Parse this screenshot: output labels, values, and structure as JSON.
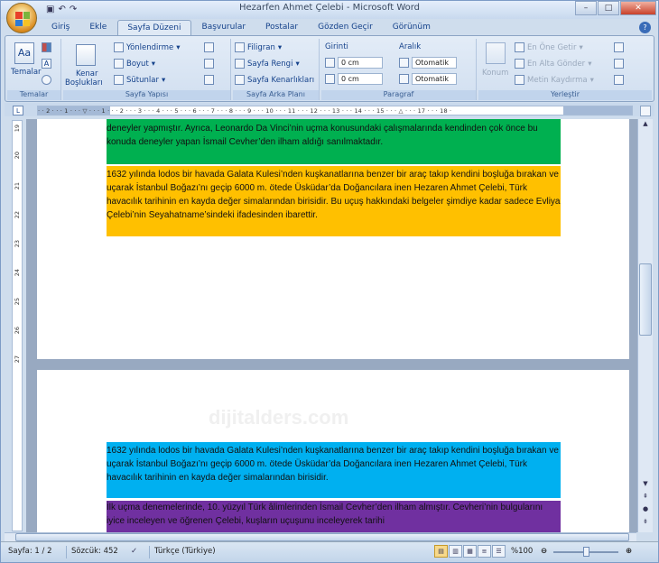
{
  "window": {
    "title": "Hezarfen Ahmet Çelebi - Microsoft Word",
    "controls": [
      "–",
      "□",
      "✕"
    ]
  },
  "quick_access": {
    "save_icon": "save-icon",
    "undo_icon": "undo-icon",
    "redo_icon": "redo-icon"
  },
  "tabs": [
    "Giriş",
    "Ekle",
    "Sayfa Düzeni",
    "Başvurular",
    "Postalar",
    "Gözden Geçir",
    "Görünüm"
  ],
  "active_tab": "Sayfa Düzeni",
  "ribbon": {
    "temalar": {
      "label": "Temalar",
      "button": "Temalar"
    },
    "sayfa_yapisi": {
      "label": "Sayfa Yapısı",
      "kenar": "Kenar",
      "bosluklari": "Boşlukları",
      "yonlendirme": "Yönlendirme",
      "boyut": "Boyut",
      "sutunlar": "Sütunlar"
    },
    "sayfa_arka_plani": {
      "label": "Sayfa Arka Planı",
      "filigran": "Filigran",
      "sayfa_rengi": "Sayfa Rengi",
      "sayfa_kenarliklari": "Sayfa Kenarlıkları"
    },
    "paragraf": {
      "label": "Paragraf",
      "girinti": "Girinti",
      "aralik": "Aralık",
      "girinti_sol": "0 cm",
      "girinti_sag": "0 cm",
      "aralik_once": "Otomatik",
      "aralik_sonra": "Otomatik"
    },
    "yerlestir": {
      "label": "Yerleştir",
      "konum": "Konum",
      "en_one": "En Öne Getir",
      "en_alta": "En Alta Gönder",
      "metin_kaydirma": "Metin Kaydırma"
    }
  },
  "ruler_text": "· · 2 · · · 1 · · · ▽ · · · 1 · · · 2 · · · 3 · · · 4 · · · 5 · · · 6 · · · 7 · · · 8 · · · 9 · · · 10 · · · 11 · · · 12 · · · 13 · · · 14 · · · 15 · · · △ · · · 17 · · · 18 ·",
  "vruler_numbers": [
    "19",
    "20",
    "21",
    "22",
    "23",
    "24",
    "25",
    "26",
    "27"
  ],
  "document": {
    "p1": "deneyler yapmıştır. Ayrıca, Leonardo Da Vinci’nin uçma konusundaki  çalışmalarında kendinden çok önce bu konuda  deneyler yapan İsmail Cevher’den ilham aldığı sanılmaktadır.",
    "p2": "1632 yılında lodos bir havada Galata Kulesi’nden kuşkanatlarına benzer bir araç takıp kendini boşluğa bırakan ve uçarak İstanbul  Boğazı’nı geçip 6000 m. ötede Üsküdar’da  Doğancılara inen Hezaren Ahmet Çelebi, Türk havacılık tarihinin en kayda değer simalarından birisidir. Bu uçuş hakkındaki  belgeler şimdiye kadar sadece Evliya Çelebi’nin Seyahatname’sindeki ifadesinden ibarettir.",
    "watermark": "dijitalders.com",
    "p3": "1632 yılında lodos bir havada Galata Kulesi’nden kuşkanatlarına benzer bir araç takıp kendini boşluğa bırakan ve uçarak İstanbul Boğazı’nı geçip 6000 m. ötede Üsküdar’da Doğancılara inen Hezaren Ahmet Çelebi, Türk havacılık tarihinin en kayda değer simalarından birisidir.",
    "p4": "İlk uçma denemelerinde, 10. yüzyıl Türk âlimlerinden İsmail Cevher’den ilham almıştır. Cevheri’nin bulgularını iyice inceleyen ve öğrenen Çelebi, kuşların uçuşunu  inceleyerek tarihi"
  },
  "highlight_colors": {
    "p1": "#00b050",
    "p2": "#ffc000",
    "p3": "#00b0f0",
    "p4": "#7030a0"
  },
  "status": {
    "page": "Sayfa: 1 / 2",
    "words": "Sözcük: 452",
    "language": "Türkçe (Türkiye)",
    "zoom": "%100"
  }
}
